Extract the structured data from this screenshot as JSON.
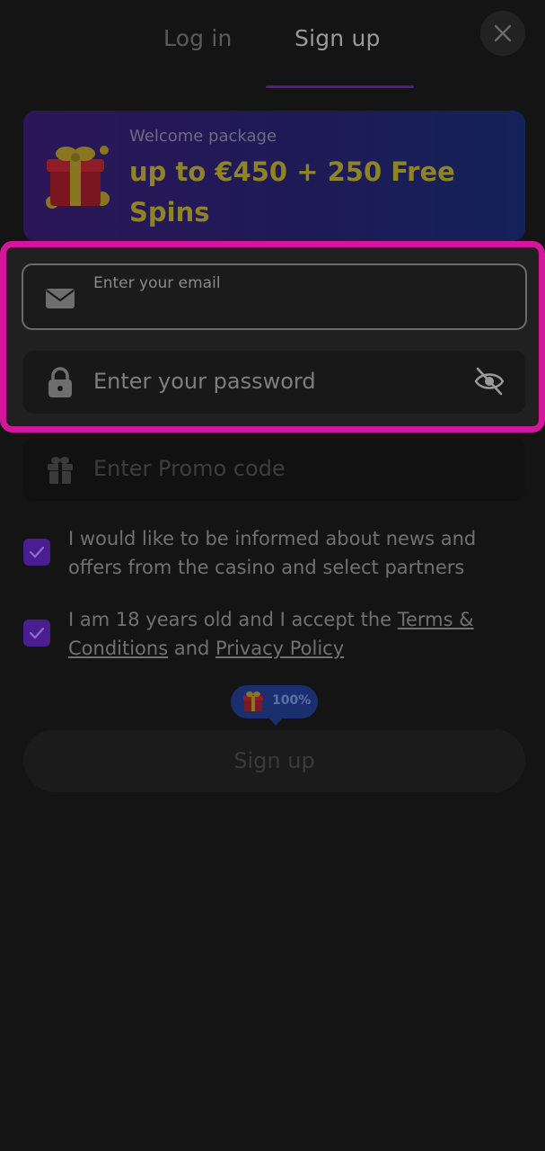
{
  "tabs": {
    "login_label": "Log in",
    "signup_label": "Sign up"
  },
  "banner": {
    "subtitle": "Welcome package",
    "title": "up to €450 + 250 Free Spins"
  },
  "form": {
    "email_label": "Enter your email",
    "password_placeholder": "Enter your password",
    "promo_placeholder": "Enter Promo code"
  },
  "consents": {
    "news_text": "I would like to be informed about news and offers from the casino and select partners",
    "age_text_prefix": "I am 18 years old and I accept the ",
    "terms_link": "Terms & Conditions",
    "age_text_middle": " and ",
    "privacy_link": "Privacy Policy"
  },
  "badge": {
    "percent": "100%"
  },
  "submit": {
    "label": "Sign up"
  },
  "colors": {
    "background": "#141414",
    "accent_purple": "#4a1d91",
    "highlight_magenta": "#d4169a",
    "banner_gold": "#8f8424"
  },
  "icons": [
    "close-icon",
    "gift-icon",
    "mail-icon",
    "lock-icon",
    "eye-off-icon",
    "checkmark-icon"
  ]
}
